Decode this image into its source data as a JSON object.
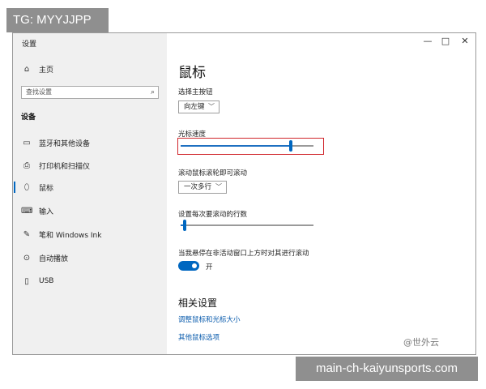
{
  "overlay": {
    "top_label": "TG: MYYJJPP",
    "bottom_label": "main-ch-kaiyunsports.com"
  },
  "window": {
    "title": "设置",
    "controls": {
      "minimize": "—",
      "maximize": "□",
      "close": "✕"
    }
  },
  "sidebar": {
    "home": {
      "label": "主页",
      "icon": "home-icon"
    },
    "search": {
      "placeholder": "查找设置",
      "icon": "search-icon"
    },
    "section_title": "设备",
    "items": [
      {
        "label": "蓝牙和其他设备",
        "icon": "bluetooth-device-icon"
      },
      {
        "label": "打印机和扫描仪",
        "icon": "printer-icon"
      },
      {
        "label": "鼠标",
        "icon": "mouse-icon",
        "active": true
      },
      {
        "label": "输入",
        "icon": "keyboard-icon"
      },
      {
        "label": "笔和 Windows Ink",
        "icon": "pen-icon"
      },
      {
        "label": "自动播放",
        "icon": "autoplay-icon"
      },
      {
        "label": "USB",
        "icon": "usb-icon"
      }
    ]
  },
  "main": {
    "title": "鼠标",
    "primary_button": {
      "label": "选择主按钮",
      "value": "向左键"
    },
    "cursor_speed": {
      "label": "光标速度",
      "level": 0.83
    },
    "scroll_wheel": {
      "label": "滚动鼠标滚轮即可滚动",
      "value": "一次多行"
    },
    "lines_per_scroll": {
      "label": "设置每次要滚动的行数",
      "level": 0.03
    },
    "inactive_scroll": {
      "label": "当我悬停在非活动窗口上方时对其进行滚动",
      "state": "开",
      "on": true
    },
    "related": {
      "title": "相关设置",
      "links": [
        "调整鼠标和光标大小",
        "其他鼠标选项"
      ]
    }
  },
  "watermark": "@世外云",
  "colors": {
    "accent": "#0067c0",
    "highlight": "#d0262c",
    "sidebar_bg": "#f0f0f0"
  }
}
